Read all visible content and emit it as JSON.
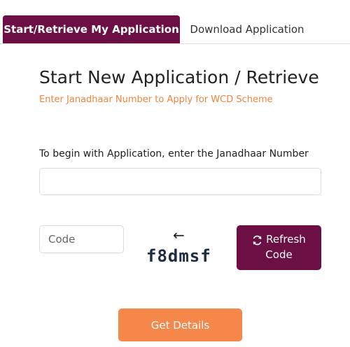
{
  "tabs": {
    "active": "Start/Retrieve My Application",
    "inactive": "Download Application"
  },
  "form": {
    "title": "Start New Application / Retrieve",
    "subtitle": "Enter Janadhaar Number to Apply for WCD Scheme",
    "janadhaar_label": "To begin with Application, enter the Janadhaar Number",
    "janadhaar_value": "",
    "code_placeholder": "Code",
    "code_value": "",
    "captcha_text": "f8dmsf",
    "refresh_label_1": "Refresh",
    "refresh_label_2": "Code",
    "get_details_label": "Get Details"
  },
  "icons": {
    "arrow": "arrow-left-icon",
    "refresh": "refresh-icon"
  },
  "colors": {
    "primary": "#6b0f45",
    "accent": "#f6874a",
    "subtitle": "#f0843e"
  }
}
